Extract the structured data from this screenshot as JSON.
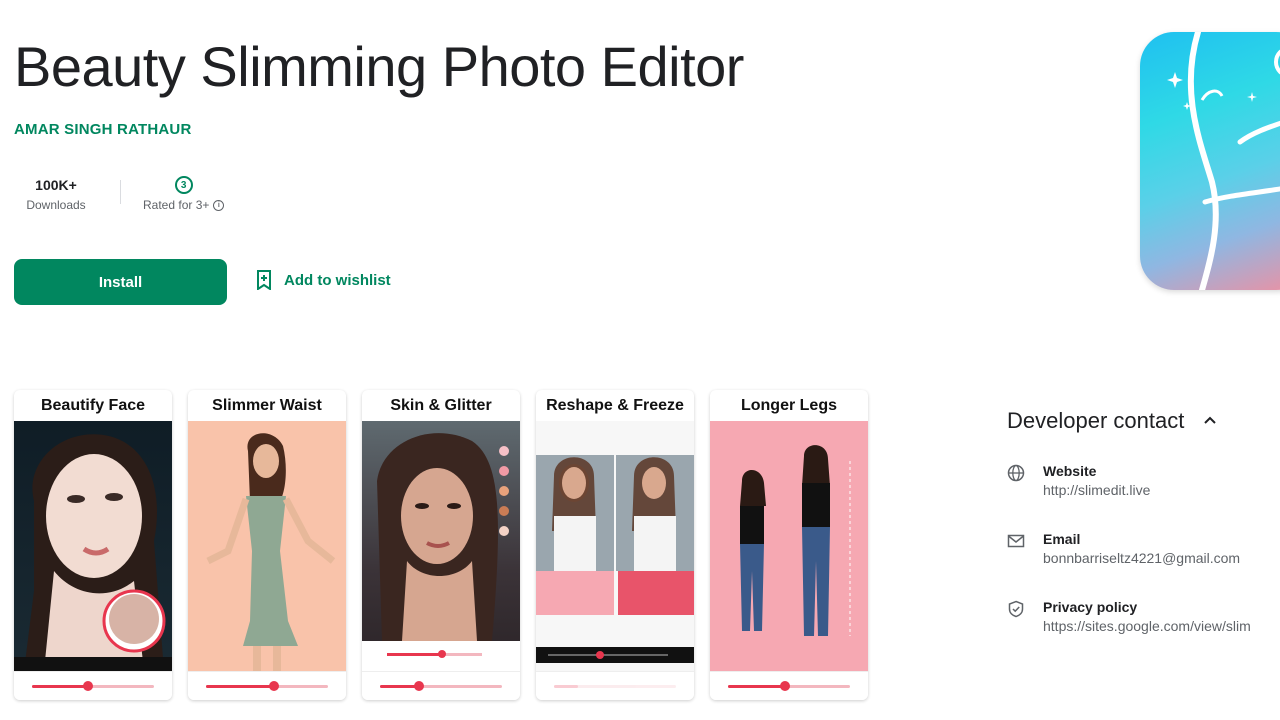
{
  "app": {
    "title": "Beauty Slimming Photo Editor",
    "developer": "AMAR SINGH RATHAUR"
  },
  "stats": {
    "downloads_value": "100K+",
    "downloads_label": "Downloads",
    "rating_label": "Rated for 3+"
  },
  "actions": {
    "install_label": "Install",
    "wishlist_label": "Add to wishlist"
  },
  "screenshots": [
    {
      "caption": "Beautify Face"
    },
    {
      "caption": "Slimmer Waist"
    },
    {
      "caption": "Skin & Glitter"
    },
    {
      "caption": "Reshape & Freeze"
    },
    {
      "caption": "Longer Legs"
    }
  ],
  "developer_contact": {
    "heading": "Developer contact",
    "website_label": "Website",
    "website_value": "http://slimedit.live",
    "email_label": "Email",
    "email_value": "bonnbarriseltz4221@gmail.com",
    "privacy_label": "Privacy policy",
    "privacy_value": "https://sites.google.com/view/slim"
  },
  "colors": {
    "accent": "#01875f",
    "text": "#202124",
    "muted": "#5f6368"
  }
}
